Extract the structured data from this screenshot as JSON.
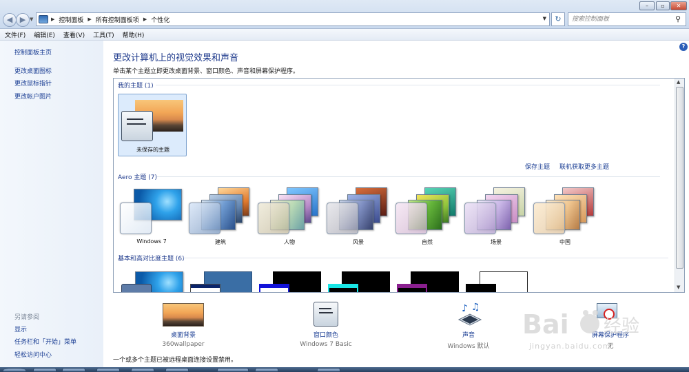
{
  "window": {
    "breadcrumbs": [
      "控制面板",
      "所有控制面板项",
      "个性化"
    ],
    "search_placeholder": "搜索控制面板",
    "buttons": {
      "minimize": "–",
      "maximize": "▫",
      "close": "✕"
    }
  },
  "menu": [
    "文件(F)",
    "编辑(E)",
    "查看(V)",
    "工具(T)",
    "帮助(H)"
  ],
  "sidebar": {
    "home": "控制面板主页",
    "links": [
      "更改桌面图标",
      "更改鼠标指针",
      "更改帐户图片"
    ],
    "see_also_title": "另请参阅",
    "see_also": [
      "显示",
      "任务栏和「开始」菜单",
      "轻松访问中心"
    ]
  },
  "main": {
    "title": "更改计算机上的视觉效果和声音",
    "description": "单击某个主题立即更改桌面背景、窗口颜色、声音和屏幕保护程序。",
    "my_themes": {
      "header": "我的主题 (1)",
      "items": [
        "未保存的主题"
      ]
    },
    "save_theme": "保存主题",
    "get_more": "联机获取更多主题",
    "aero": {
      "header": "Aero 主题 (7)",
      "items": [
        "Windows 7",
        "建筑",
        "人物",
        "风景",
        "自然",
        "场景",
        "中国"
      ]
    },
    "basic": {
      "header": "基本和高对比度主题 (6)"
    },
    "help_icon": "?"
  },
  "bottom": {
    "items": [
      {
        "title": "桌面背景",
        "subtitle": "360wallpaper"
      },
      {
        "title": "窗口颜色",
        "subtitle": "Windows 7 Basic"
      },
      {
        "title": "声音",
        "subtitle": "Windows 默认"
      },
      {
        "title": "屏幕保护程序",
        "subtitle": "无"
      }
    ],
    "notice": "一个或多个主题已被远程桌面连接设置禁用。"
  },
  "watermark": {
    "text": "jingyan.baidu.com"
  },
  "colors": {
    "link": "#1c3f94",
    "title": "#1e3a8c",
    "selection": "#dcebfc"
  }
}
